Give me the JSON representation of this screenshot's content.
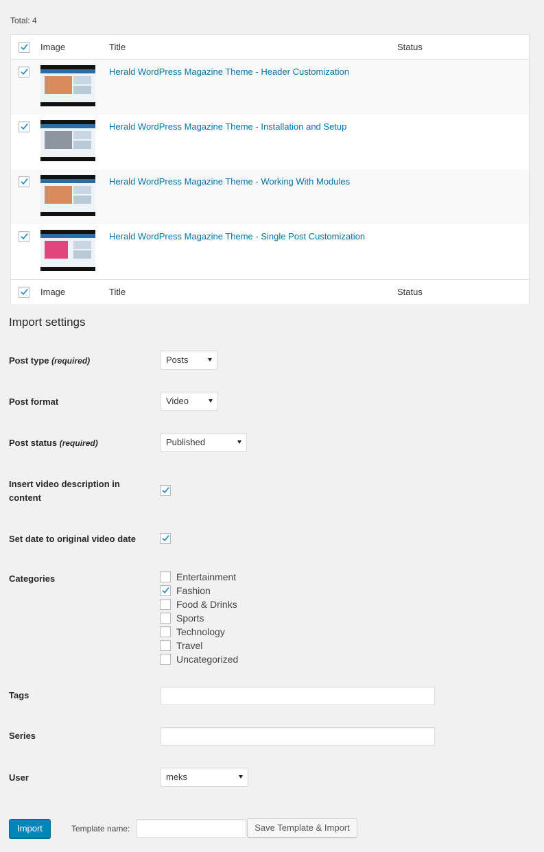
{
  "total_text": "Total: 4",
  "table": {
    "columns": {
      "image": "Image",
      "title": "Title",
      "status": "Status"
    },
    "rows": [
      {
        "title": "Herald WordPress Magazine Theme - Header Customization",
        "checked": true
      },
      {
        "title": "Herald WordPress Magazine Theme - Installation and Setup",
        "checked": true
      },
      {
        "title": "Herald WordPress Magazine Theme - Working With Modules",
        "checked": true
      },
      {
        "title": "Herald WordPress Magazine Theme - Single Post Customization",
        "checked": true
      }
    ]
  },
  "settings": {
    "heading": "Import settings",
    "post_type": {
      "label": "Post type",
      "note": "(required)",
      "value": "Posts"
    },
    "post_format": {
      "label": "Post format",
      "value": "Video"
    },
    "post_status": {
      "label": "Post status",
      "note": "(required)",
      "value": "Published"
    },
    "insert_description": {
      "label_line1": "Insert video description in",
      "label_line2": "content",
      "checked": true
    },
    "set_date": {
      "label": "Set date to original video date",
      "checked": true
    },
    "categories": {
      "label": "Categories",
      "items": [
        {
          "name": "Entertainment",
          "checked": false
        },
        {
          "name": "Fashion",
          "checked": true
        },
        {
          "name": "Food & Drinks",
          "checked": false
        },
        {
          "name": "Sports",
          "checked": false
        },
        {
          "name": "Technology",
          "checked": false
        },
        {
          "name": "Travel",
          "checked": false
        },
        {
          "name": "Uncategorized",
          "checked": false
        }
      ]
    },
    "tags": {
      "label": "Tags",
      "value": ""
    },
    "series": {
      "label": "Series",
      "value": ""
    },
    "user": {
      "label": "User",
      "value": "meks"
    }
  },
  "actions": {
    "import_label": "Import",
    "template_name_label": "Template name:",
    "template_name_value": "",
    "save_template_label": "Save Template & Import"
  },
  "colors": {
    "link": "#0073aa",
    "primary_button": "#0085ba",
    "checkmark": "#1e8cbe"
  }
}
